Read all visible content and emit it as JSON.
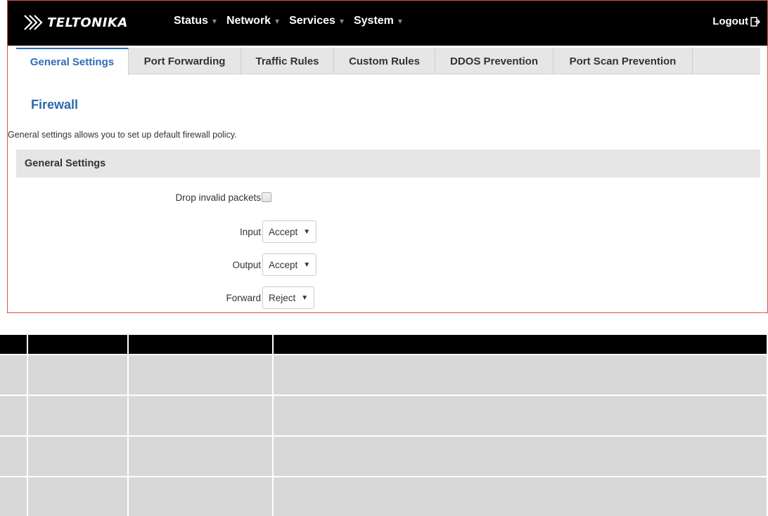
{
  "logo": {
    "text": "TELTONIKA",
    "icon": "teltonika-logo-icon"
  },
  "nav": {
    "items": [
      {
        "label": "Status"
      },
      {
        "label": "Network"
      },
      {
        "label": "Services"
      },
      {
        "label": "System"
      }
    ],
    "logout_label": "Logout",
    "logout_icon": "logout-icon"
  },
  "tabs": [
    {
      "label": "General Settings",
      "active": true
    },
    {
      "label": "Port Forwarding"
    },
    {
      "label": "Traffic Rules"
    },
    {
      "label": "Custom Rules"
    },
    {
      "label": "DDOS Prevention"
    },
    {
      "label": "Port Scan Prevention"
    }
  ],
  "page": {
    "title": "Firewall",
    "description": "General settings allows you to set up default firewall policy.",
    "section_title": "General Settings"
  },
  "form": {
    "drop_invalid": {
      "label": "Drop invalid packets",
      "checked": false
    },
    "input": {
      "label": "Input",
      "value": "Accept"
    },
    "output": {
      "label": "Output",
      "value": "Accept"
    },
    "forward": {
      "label": "Forward",
      "value": "Reject"
    }
  },
  "colors": {
    "topbar": "#000000",
    "accent_blue": "#2f6db5",
    "frame_border": "#d9534f",
    "section_bg": "#e6e6e6"
  }
}
